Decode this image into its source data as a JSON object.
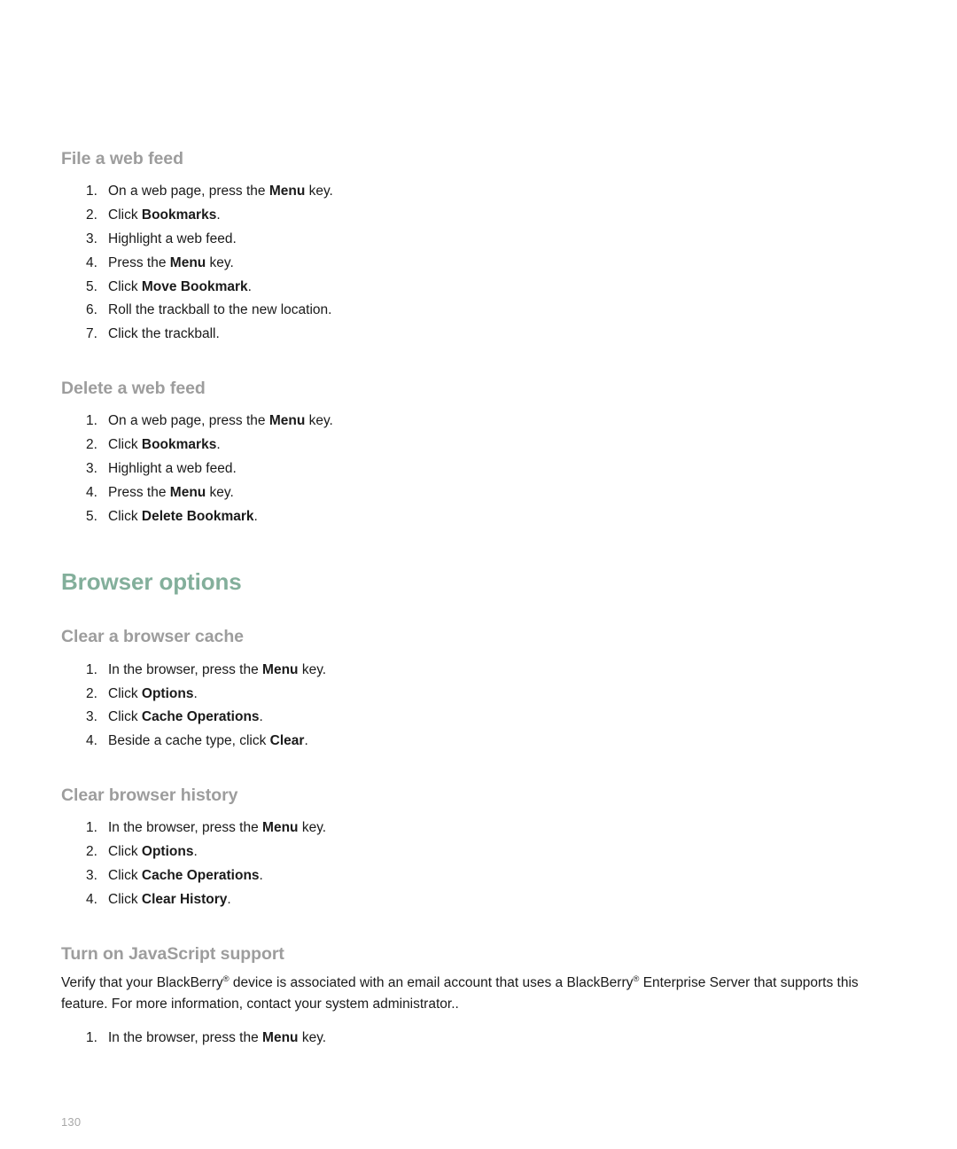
{
  "document": {
    "page_number": "130",
    "colors": {
      "chapter_heading": "#83af9b",
      "section_heading": "#9d9d9d",
      "body_text": "#1a1a1a",
      "page_number": "#a8a8a8",
      "background": "#ffffff"
    }
  },
  "sections": [
    {
      "heading": "File a web feed",
      "steps": [
        {
          "pre": "On a web page, press the ",
          "bold": "Menu",
          "post": " key."
        },
        {
          "pre": "Click ",
          "bold": "Bookmarks",
          "post": "."
        },
        {
          "pre": "Highlight a web feed.",
          "bold": "",
          "post": ""
        },
        {
          "pre": "Press the ",
          "bold": "Menu",
          "post": " key."
        },
        {
          "pre": "Click ",
          "bold": "Move Bookmark",
          "post": "."
        },
        {
          "pre": "Roll the trackball to the new location.",
          "bold": "",
          "post": ""
        },
        {
          "pre": "Click the trackball.",
          "bold": "",
          "post": ""
        }
      ]
    },
    {
      "heading": "Delete a web feed",
      "steps": [
        {
          "pre": "On a web page, press the ",
          "bold": "Menu",
          "post": " key."
        },
        {
          "pre": "Click ",
          "bold": "Bookmarks",
          "post": "."
        },
        {
          "pre": "Highlight a web feed.",
          "bold": "",
          "post": ""
        },
        {
          "pre": "Press the ",
          "bold": "Menu",
          "post": " key."
        },
        {
          "pre": "Click ",
          "bold": "Delete Bookmark",
          "post": "."
        }
      ]
    }
  ],
  "chapter": {
    "title": "Browser options"
  },
  "subsections": [
    {
      "heading": "Clear a browser cache",
      "steps": [
        {
          "pre": "In the browser, press the ",
          "bold": "Menu",
          "post": " key."
        },
        {
          "pre": "Click ",
          "bold": "Options",
          "post": "."
        },
        {
          "pre": "Click ",
          "bold": "Cache Operations",
          "post": "."
        },
        {
          "pre": "Beside a cache type, click ",
          "bold": "Clear",
          "post": "."
        }
      ]
    },
    {
      "heading": "Clear browser history",
      "steps": [
        {
          "pre": "In the browser, press the ",
          "bold": "Menu",
          "post": " key."
        },
        {
          "pre": "Click ",
          "bold": "Options",
          "post": "."
        },
        {
          "pre": "Click ",
          "bold": "Cache Operations",
          "post": "."
        },
        {
          "pre": "Click ",
          "bold": "Clear History",
          "post": "."
        }
      ]
    },
    {
      "heading": "Turn on JavaScript support",
      "paragraph": {
        "part1": "Verify that your BlackBerry",
        "reg1": "®",
        "part2": " device is associated with an email account that uses a BlackBerry",
        "reg2": "®",
        "part3": " Enterprise Server that supports this feature. For more information, contact your system administrator.."
      },
      "steps": [
        {
          "pre": "In the browser, press the ",
          "bold": "Menu",
          "post": " key."
        }
      ]
    }
  ]
}
